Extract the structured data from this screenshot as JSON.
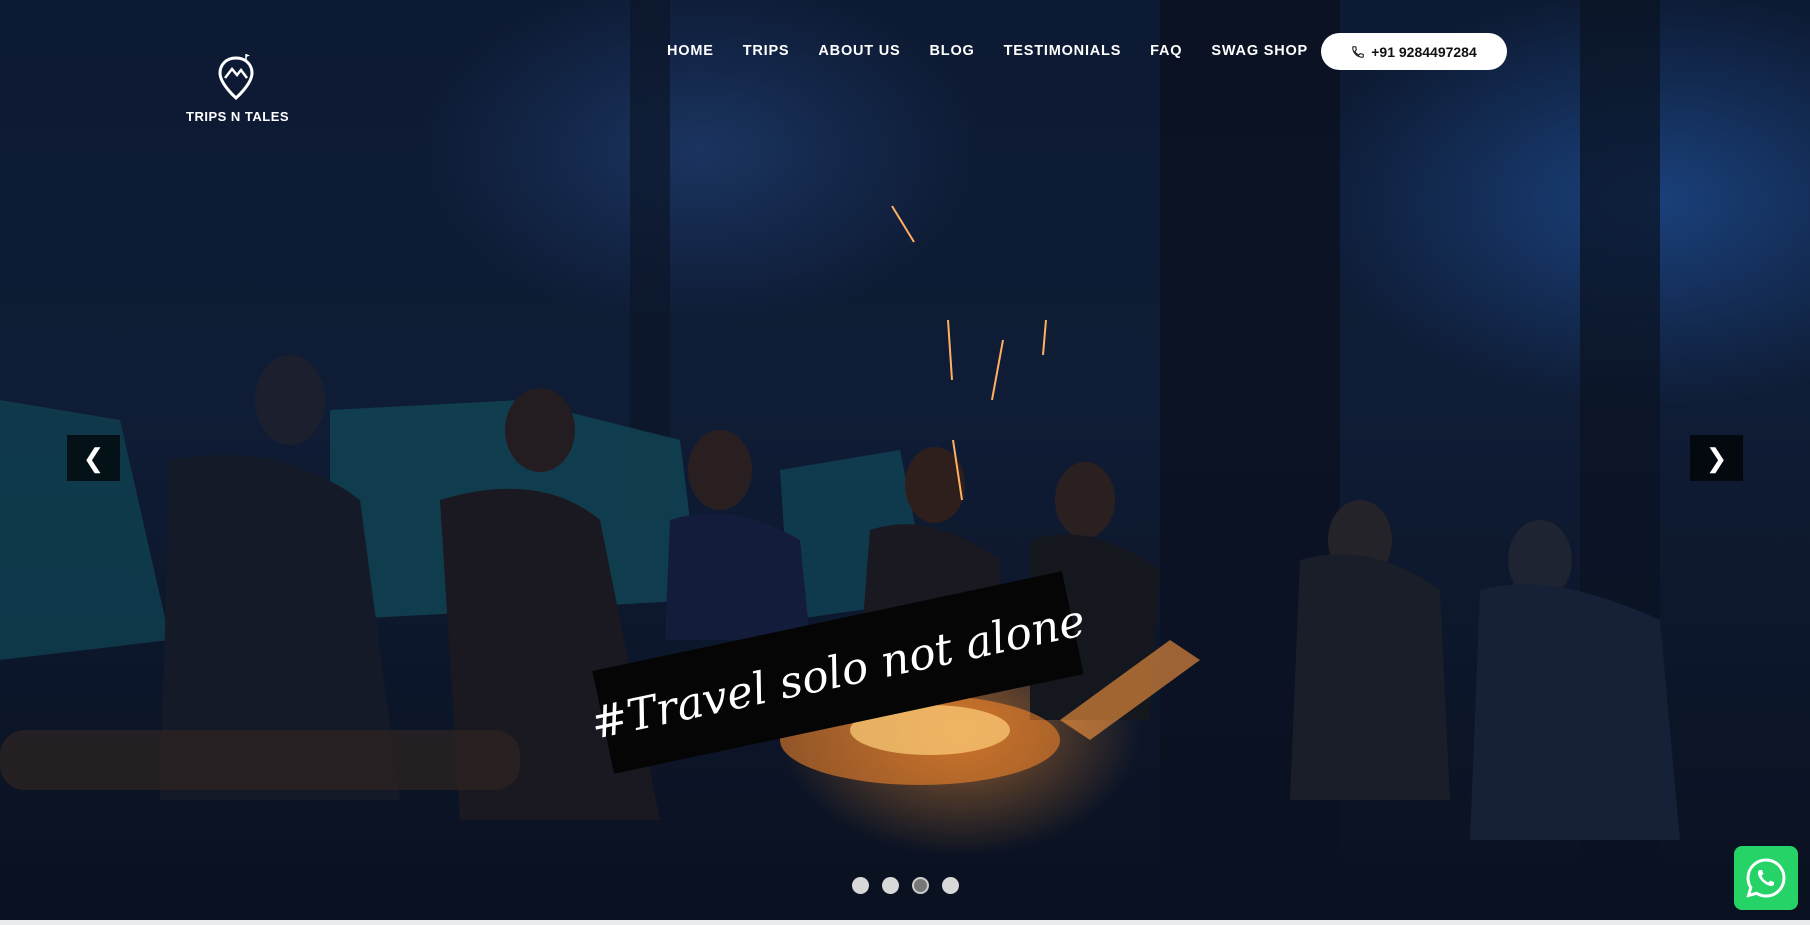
{
  "brand": {
    "name": "TRIPS N TALES"
  },
  "nav": {
    "items": [
      {
        "label": "HOME"
      },
      {
        "label": "TRIPS"
      },
      {
        "label": "ABOUT US"
      },
      {
        "label": "BLOG"
      },
      {
        "label": "TESTIMONIALS"
      },
      {
        "label": "FAQ"
      },
      {
        "label": "SWAG SHOP"
      }
    ],
    "phone": "+91 9284497284"
  },
  "hero": {
    "tagline": "#Travel solo not alone",
    "prev_arrow": "❮",
    "next_arrow": "❯",
    "slides_count": 4,
    "active_slide": 3
  },
  "icons": {
    "logo": "map-pin-mountain-icon",
    "phone": "phone-icon",
    "whatsapp": "whatsapp-icon"
  },
  "colors": {
    "whatsapp": "#25d366",
    "banner_bg": "#050505"
  }
}
